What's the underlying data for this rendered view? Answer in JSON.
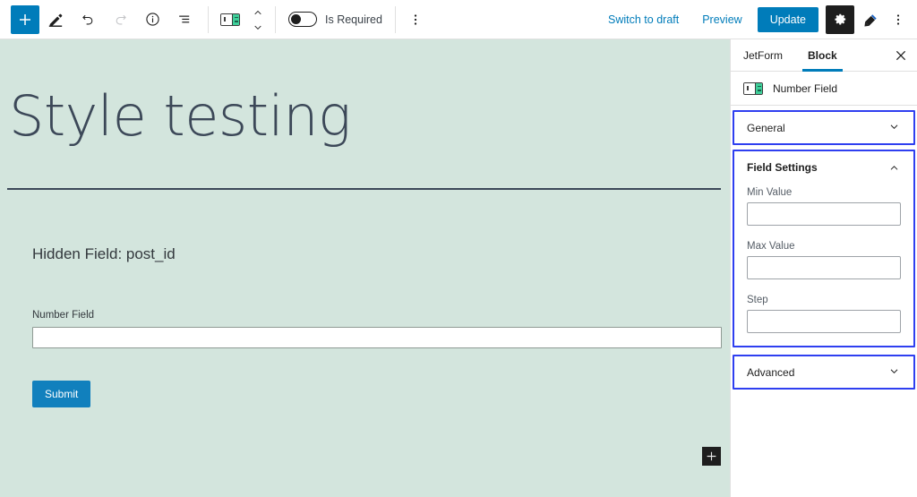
{
  "toolbar": {
    "add_block_icon": "plus-icon",
    "edit_mode_icon": "pencil-icon",
    "undo_icon": "undo-arrow-icon",
    "redo_icon": "redo-arrow-icon",
    "details_icon": "info-circle-icon",
    "list_view_icon": "list-view-icon",
    "block_type_icon": "number-field-block-icon",
    "stepper_up_icon": "chevron-up-icon",
    "stepper_down_icon": "chevron-down-icon",
    "toggle_label": "Is Required",
    "toggle_state": "off",
    "block_options_icon": "kebab-menu-icon",
    "switch_to_draft": "Switch to draft",
    "preview": "Preview",
    "update": "Update",
    "settings_icon": "gear-icon",
    "styles_icon": "brush-icon",
    "more_icon": "kebab-menu-icon",
    "accent_color": "#007cba"
  },
  "canvas": {
    "background_color": "#d3e5dd",
    "post_title": "Style testing",
    "hidden_field": "Hidden Field: post_id",
    "number_field_label": "Number Field",
    "number_field_value": "",
    "submit_label": "Submit",
    "submit_color": "#1180bd",
    "appender_icon": "plus-icon"
  },
  "sidebar": {
    "tabs": [
      {
        "label": "JetForm",
        "active": false
      },
      {
        "label": "Block",
        "active": true
      }
    ],
    "close_icon": "close-icon",
    "block_icon": "number-field-block-icon",
    "block_name": "Number Field",
    "panels": [
      {
        "title": "General",
        "expanded": false,
        "chevron": "chevron-down-icon"
      },
      {
        "title": "Field Settings",
        "expanded": true,
        "chevron": "chevron-up-icon"
      },
      {
        "title": "Advanced",
        "expanded": false,
        "chevron": "chevron-down-icon"
      }
    ],
    "field_settings": {
      "min_value": {
        "label": "Min Value",
        "value": ""
      },
      "max_value": {
        "label": "Max Value",
        "value": ""
      },
      "step": {
        "label": "Step",
        "value": ""
      }
    },
    "highlight_color": "#2f3ff0"
  }
}
